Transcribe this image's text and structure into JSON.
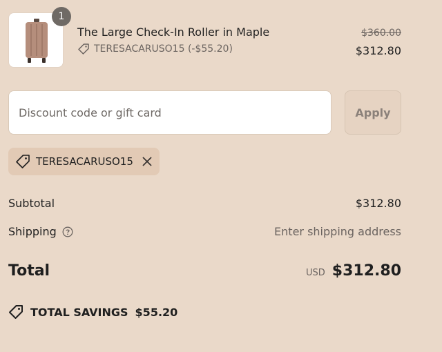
{
  "colors": {
    "background": "#ead9c9",
    "text": "#1f1f1f",
    "muted_text": "#6b6460",
    "chip_background": "#e2cab5",
    "apply_button_background": "#e6d3c2"
  },
  "line_item": {
    "quantity": "1",
    "title": "The Large Check-In Roller in Maple",
    "discount_label": "TERESACARUSO15 (-$55.20)",
    "original_price": "$360.00",
    "price": "$312.80",
    "image_icon": "suitcase-icon"
  },
  "discount_form": {
    "placeholder": "Discount code or gift card",
    "value": "",
    "apply_label": "Apply"
  },
  "applied_code": {
    "code": "TERESACARUSO15",
    "tag_icon": "tag-icon",
    "remove_icon": "close-icon"
  },
  "summary": {
    "subtotal_label": "Subtotal",
    "subtotal_value": "$312.80",
    "shipping_label": "Shipping",
    "shipping_info_icon": "help-circle-icon",
    "shipping_value": "Enter shipping address",
    "total_label": "Total",
    "currency": "USD",
    "total_value": "$312.80"
  },
  "savings": {
    "label": "TOTAL SAVINGS",
    "value": "$55.20",
    "icon": "savings-tag-icon"
  }
}
